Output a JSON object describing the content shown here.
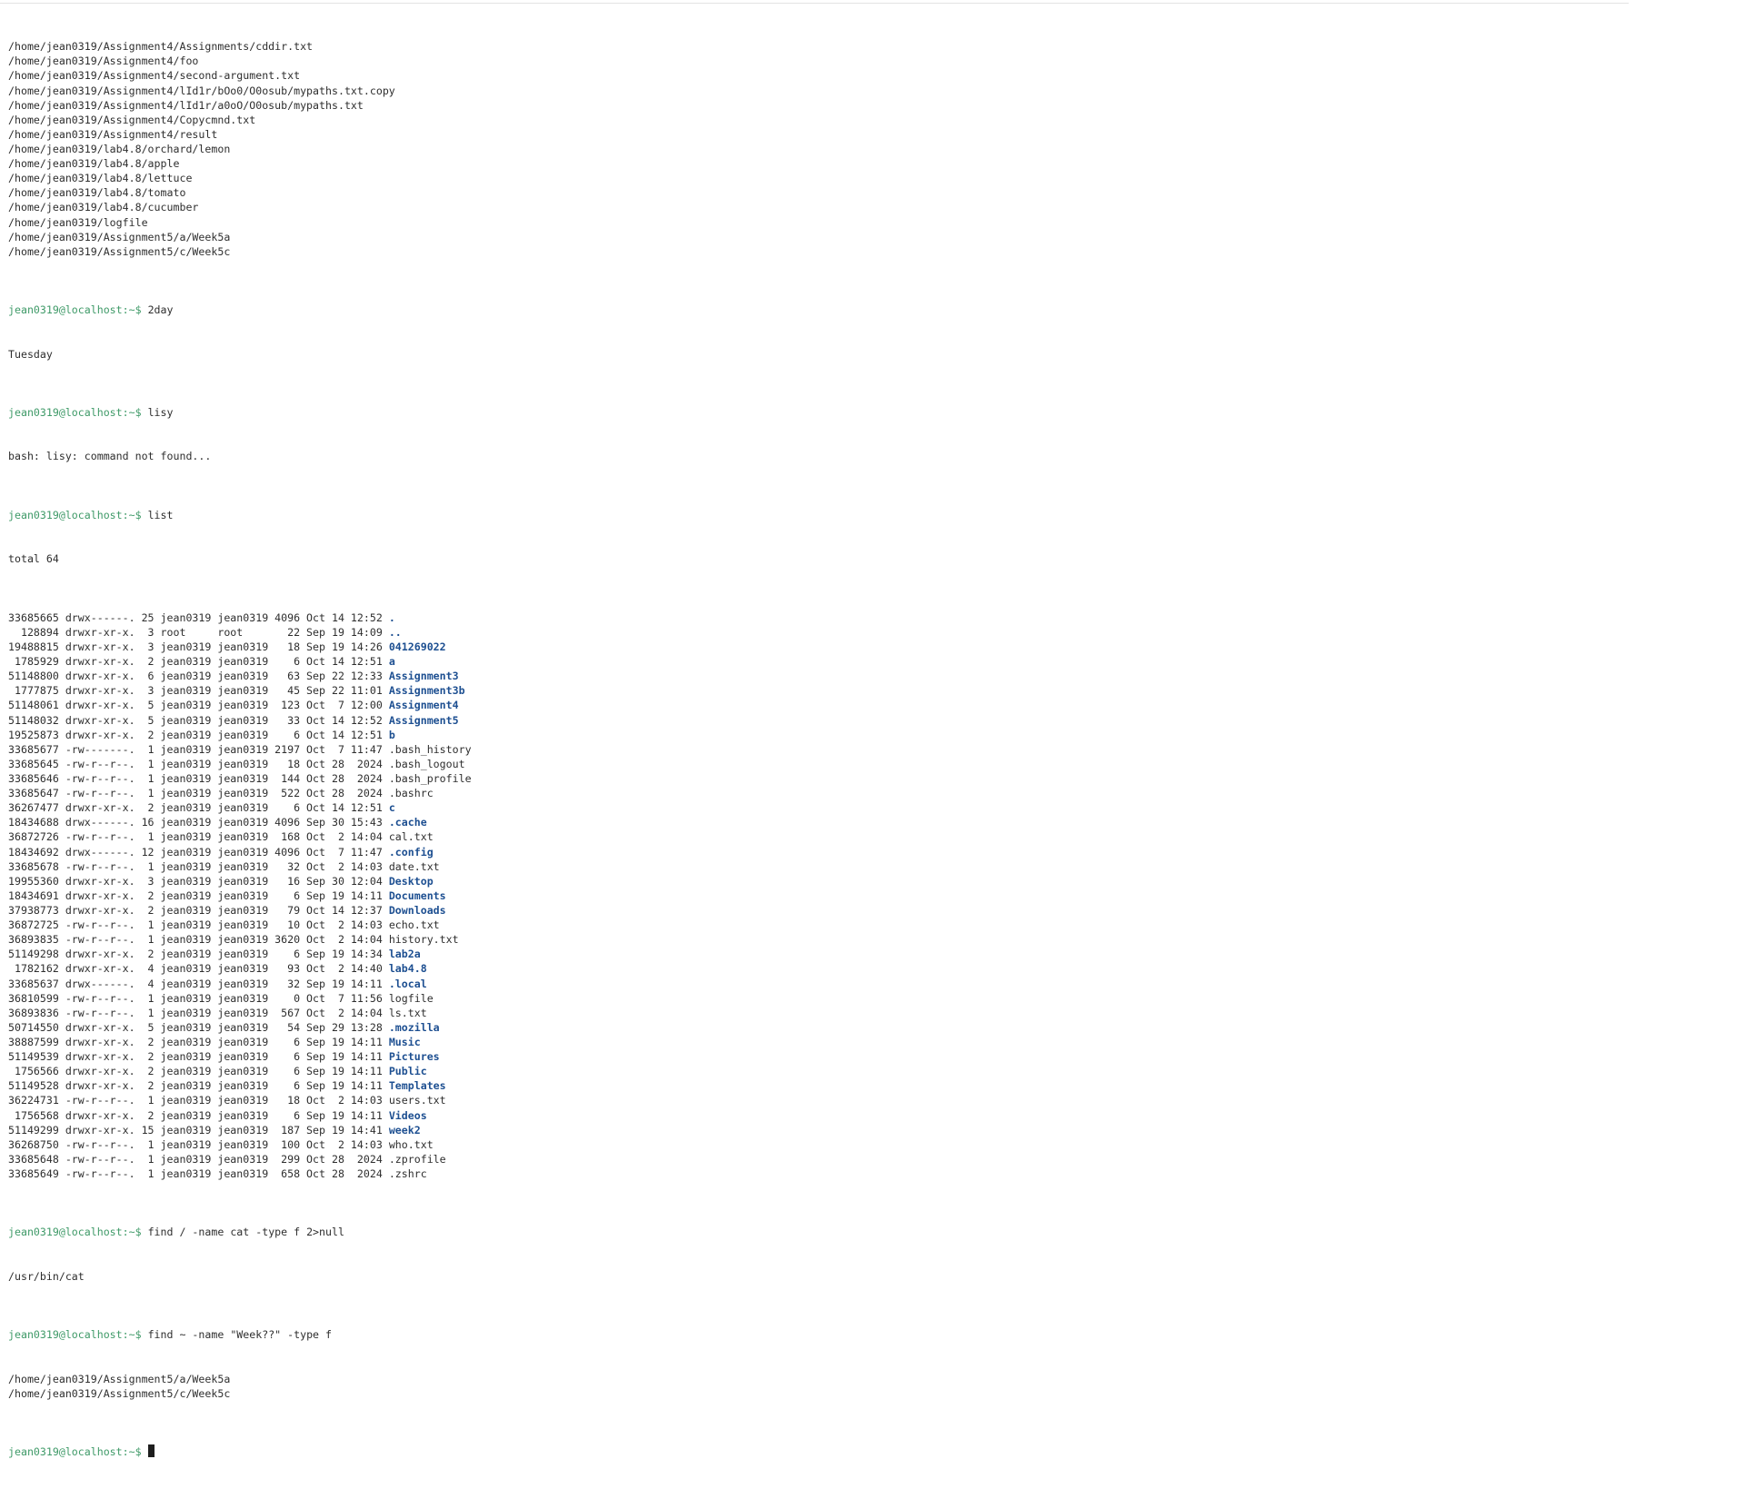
{
  "terminal": {
    "prompt": "jean0319@localhost:~$",
    "top_output": [
      "/home/jean0319/Assignment4/Assignments/cddir.txt",
      "/home/jean0319/Assignment4/foo",
      "/home/jean0319/Assignment4/second-argument.txt",
      "/home/jean0319/Assignment4/lId1r/bOo0/O0osub/mypaths.txt.copy",
      "/home/jean0319/Assignment4/lId1r/a0oO/O0osub/mypaths.txt",
      "/home/jean0319/Assignment4/Copycmnd.txt",
      "/home/jean0319/Assignment4/result",
      "/home/jean0319/lab4.8/orchard/lemon",
      "/home/jean0319/lab4.8/apple",
      "/home/jean0319/lab4.8/lettuce",
      "/home/jean0319/lab4.8/tomato",
      "/home/jean0319/lab4.8/cucumber",
      "/home/jean0319/logfile",
      "/home/jean0319/Assignment5/a/Week5a",
      "/home/jean0319/Assignment5/c/Week5c"
    ],
    "cmd_2day": " 2day",
    "out_2day": "Tuesday",
    "cmd_lisy": " lisy",
    "out_lisy": "bash: lisy: command not found...",
    "cmd_list": " list",
    "total": "total 64",
    "listing": [
      {
        "info": "33685665 drwx------. 25 jean0319 jean0319 4096 Oct 14 12:52 ",
        "name": ".",
        "dir": true
      },
      {
        "info": "  128894 drwxr-xr-x.  3 root     root       22 Sep 19 14:09 ",
        "name": "..",
        "dir": true
      },
      {
        "info": "19488815 drwxr-xr-x.  3 jean0319 jean0319   18 Sep 19 14:26 ",
        "name": "041269022",
        "dir": true
      },
      {
        "info": " 1785929 drwxr-xr-x.  2 jean0319 jean0319    6 Oct 14 12:51 ",
        "name": "a",
        "dir": true
      },
      {
        "info": "51148800 drwxr-xr-x.  6 jean0319 jean0319   63 Sep 22 12:33 ",
        "name": "Assignment3",
        "dir": true
      },
      {
        "info": " 1777875 drwxr-xr-x.  3 jean0319 jean0319   45 Sep 22 11:01 ",
        "name": "Assignment3b",
        "dir": true
      },
      {
        "info": "51148061 drwxr-xr-x.  5 jean0319 jean0319  123 Oct  7 12:00 ",
        "name": "Assignment4",
        "dir": true
      },
      {
        "info": "51148032 drwxr-xr-x.  5 jean0319 jean0319   33 Oct 14 12:52 ",
        "name": "Assignment5",
        "dir": true
      },
      {
        "info": "19525873 drwxr-xr-x.  2 jean0319 jean0319    6 Oct 14 12:51 ",
        "name": "b",
        "dir": true
      },
      {
        "info": "33685677 -rw-------.  1 jean0319 jean0319 2197 Oct  7 11:47 ",
        "name": ".bash_history",
        "dir": false
      },
      {
        "info": "33685645 -rw-r--r--.  1 jean0319 jean0319   18 Oct 28  2024 ",
        "name": ".bash_logout",
        "dir": false
      },
      {
        "info": "33685646 -rw-r--r--.  1 jean0319 jean0319  144 Oct 28  2024 ",
        "name": ".bash_profile",
        "dir": false
      },
      {
        "info": "33685647 -rw-r--r--.  1 jean0319 jean0319  522 Oct 28  2024 ",
        "name": ".bashrc",
        "dir": false
      },
      {
        "info": "36267477 drwxr-xr-x.  2 jean0319 jean0319    6 Oct 14 12:51 ",
        "name": "c",
        "dir": true
      },
      {
        "info": "18434688 drwx------. 16 jean0319 jean0319 4096 Sep 30 15:43 ",
        "name": ".cache",
        "dir": true
      },
      {
        "info": "36872726 -rw-r--r--.  1 jean0319 jean0319  168 Oct  2 14:04 ",
        "name": "cal.txt",
        "dir": false
      },
      {
        "info": "18434692 drwx------. 12 jean0319 jean0319 4096 Oct  7 11:47 ",
        "name": ".config",
        "dir": true
      },
      {
        "info": "33685678 -rw-r--r--.  1 jean0319 jean0319   32 Oct  2 14:03 ",
        "name": "date.txt",
        "dir": false
      },
      {
        "info": "19955360 drwxr-xr-x.  3 jean0319 jean0319   16 Sep 30 12:04 ",
        "name": "Desktop",
        "dir": true
      },
      {
        "info": "18434691 drwxr-xr-x.  2 jean0319 jean0319    6 Sep 19 14:11 ",
        "name": "Documents",
        "dir": true
      },
      {
        "info": "37938773 drwxr-xr-x.  2 jean0319 jean0319   79 Oct 14 12:37 ",
        "name": "Downloads",
        "dir": true
      },
      {
        "info": "36872725 -rw-r--r--.  1 jean0319 jean0319   10 Oct  2 14:03 ",
        "name": "echo.txt",
        "dir": false
      },
      {
        "info": "36893835 -rw-r--r--.  1 jean0319 jean0319 3620 Oct  2 14:04 ",
        "name": "history.txt",
        "dir": false
      },
      {
        "info": "51149298 drwxr-xr-x.  2 jean0319 jean0319    6 Sep 19 14:34 ",
        "name": "lab2a",
        "dir": true
      },
      {
        "info": " 1782162 drwxr-xr-x.  4 jean0319 jean0319   93 Oct  2 14:40 ",
        "name": "lab4.8",
        "dir": true
      },
      {
        "info": "33685637 drwx------.  4 jean0319 jean0319   32 Sep 19 14:11 ",
        "name": ".local",
        "dir": true
      },
      {
        "info": "36810599 -rw-r--r--.  1 jean0319 jean0319    0 Oct  7 11:56 ",
        "name": "logfile",
        "dir": false
      },
      {
        "info": "36893836 -rw-r--r--.  1 jean0319 jean0319  567 Oct  2 14:04 ",
        "name": "ls.txt",
        "dir": false
      },
      {
        "info": "50714550 drwxr-xr-x.  5 jean0319 jean0319   54 Sep 29 13:28 ",
        "name": ".mozilla",
        "dir": true
      },
      {
        "info": "38887599 drwxr-xr-x.  2 jean0319 jean0319    6 Sep 19 14:11 ",
        "name": "Music",
        "dir": true
      },
      {
        "info": "51149539 drwxr-xr-x.  2 jean0319 jean0319    6 Sep 19 14:11 ",
        "name": "Pictures",
        "dir": true
      },
      {
        "info": " 1756566 drwxr-xr-x.  2 jean0319 jean0319    6 Sep 19 14:11 ",
        "name": "Public",
        "dir": true
      },
      {
        "info": "51149528 drwxr-xr-x.  2 jean0319 jean0319    6 Sep 19 14:11 ",
        "name": "Templates",
        "dir": true
      },
      {
        "info": "36224731 -rw-r--r--.  1 jean0319 jean0319   18 Oct  2 14:03 ",
        "name": "users.txt",
        "dir": false
      },
      {
        "info": " 1756568 drwxr-xr-x.  2 jean0319 jean0319    6 Sep 19 14:11 ",
        "name": "Videos",
        "dir": true
      },
      {
        "info": "51149299 drwxr-xr-x. 15 jean0319 jean0319  187 Sep 19 14:41 ",
        "name": "week2",
        "dir": true
      },
      {
        "info": "36268750 -rw-r--r--.  1 jean0319 jean0319  100 Oct  2 14:03 ",
        "name": "who.txt",
        "dir": false
      },
      {
        "info": "33685648 -rw-r--r--.  1 jean0319 jean0319  299 Oct 28  2024 ",
        "name": ".zprofile",
        "dir": false
      },
      {
        "info": "33685649 -rw-r--r--.  1 jean0319 jean0319  658 Oct 28  2024 ",
        "name": ".zshrc",
        "dir": false
      }
    ],
    "cmd_find_cat": " find / -name cat -type f 2>null",
    "out_find_cat": "/usr/bin/cat",
    "cmd_find_week": " find ~ -name \"Week??\" -type f",
    "out_find_week": [
      "/home/jean0319/Assignment5/a/Week5a",
      "/home/jean0319/Assignment5/c/Week5c"
    ],
    "cursor_line_suffix": " "
  },
  "colors": {
    "background": "#ffffff",
    "text": "#2e2e2e",
    "prompt": "#3f9a68",
    "directory": "#1d4f91",
    "cursor": "#1e1e1e"
  }
}
